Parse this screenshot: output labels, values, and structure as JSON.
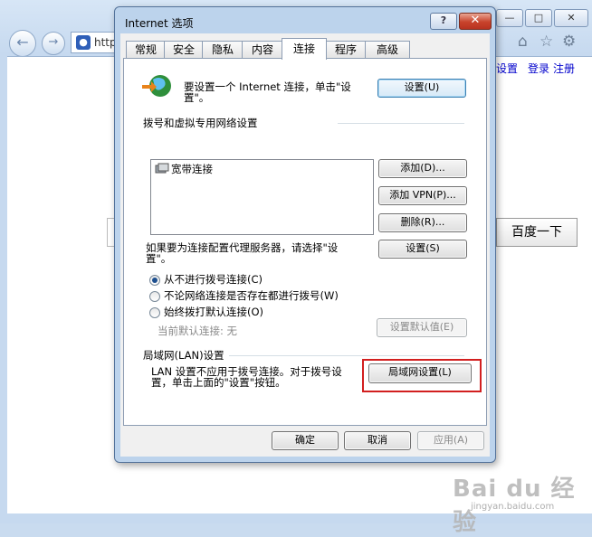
{
  "browser": {
    "address_text": "http",
    "toolbar_links": [
      "设置",
      "登录",
      "注册"
    ],
    "search_button": "百度一下",
    "watermark": "Bai du 经验",
    "watermark_sub": "jingyan.baidu.com"
  },
  "dialog": {
    "title": "Internet 选项",
    "help_label": "?",
    "close_label": "✕",
    "tabs": [
      "常规",
      "安全",
      "隐私",
      "内容",
      "连接",
      "程序",
      "高级"
    ],
    "active_tab": "连接",
    "setup": {
      "text_line1": "要设置一个 Internet 连接，单击\"设",
      "text_line2": "置\"。",
      "button": "设置(U)"
    },
    "dialup": {
      "heading": "拨号和虚拟专用网络设置",
      "list_items": [
        "宽带连接"
      ],
      "add_button": "添加(D)...",
      "add_vpn_button": "添加 VPN(P)...",
      "remove_button": "删除(R)...",
      "proxy_text_line1": "如果要为连接配置代理服务器，请选择\"设",
      "proxy_text_line2": "置\"。",
      "settings_button": "设置(S)",
      "options": [
        "从不进行拨号连接(C)",
        "不论网络连接是否存在都进行拨号(W)",
        "始终拨打默认连接(O)"
      ],
      "selected_option": "从不进行拨号连接(C)",
      "current_default": "当前默认连接: 无",
      "set_default_button": "设置默认值(E)"
    },
    "lan": {
      "heading": "局域网(LAN)设置",
      "text_line1": "LAN 设置不应用于拨号连接。对于拨号设",
      "text_line2": "置，单击上面的\"设置\"按钮。",
      "button": "局域网设置(L)"
    },
    "footer": {
      "ok": "确定",
      "cancel": "取消",
      "apply": "应用(A)"
    }
  },
  "colors": {
    "highlight": "#d21f1f",
    "close_button": "#c8432c",
    "link": "#0000cc"
  }
}
